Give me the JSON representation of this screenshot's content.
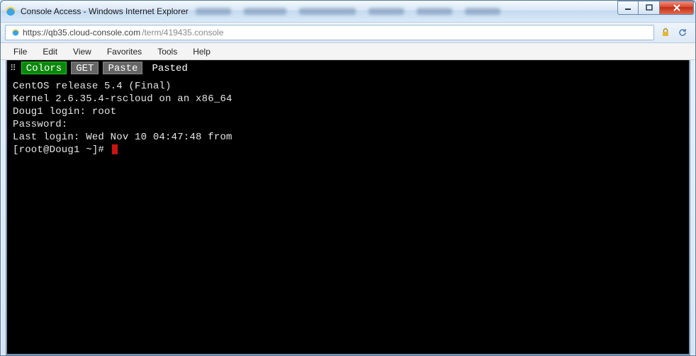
{
  "window": {
    "title": "Console Access - Windows Internet Explorer"
  },
  "address": {
    "host": "https://qb35.cloud-console.com",
    "path": "/term/419435.console"
  },
  "menu": {
    "file": "File",
    "edit": "Edit",
    "view": "View",
    "favorites": "Favorites",
    "tools": "Tools",
    "help": "Help"
  },
  "console_bar": {
    "colors": "Colors",
    "get": "GET",
    "paste": "Paste",
    "pasted": "Pasted"
  },
  "terminal": {
    "line1": "CentOS release 5.4 (Final)",
    "line2": "Kernel 2.6.35.4-rscloud on an x86_64",
    "blank1": "",
    "line3": "Doug1 login: root",
    "line4": "Password:",
    "line5": "Last login: Wed Nov 10 04:47:48 from",
    "prompt": "[root@Doug1 ~]# "
  }
}
